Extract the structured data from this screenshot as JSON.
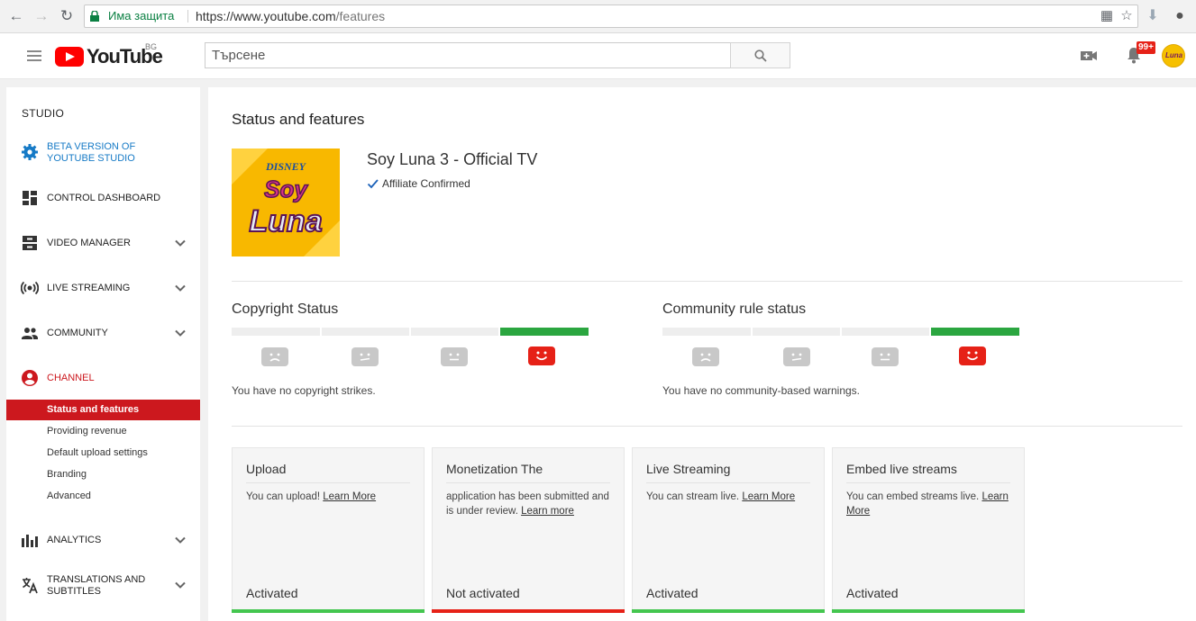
{
  "browser": {
    "secure_text": "Има защита",
    "url_host": "https://www.youtube.com",
    "url_path": "/features"
  },
  "masthead": {
    "logo_text": "YouTube",
    "region": "BG",
    "search_placeholder": "Търсене",
    "notification_count": "99+",
    "avatar_text": "Luna"
  },
  "sidebar": {
    "studio_label": "STUDIO",
    "items": [
      {
        "label": "BETA VERSION OF YOUTUBE STUDIO",
        "icon": "gear-icon"
      },
      {
        "label": "CONTROL DASHBOARD",
        "icon": "dashboard-icon"
      },
      {
        "label": "VIDEO MANAGER",
        "icon": "video-manager-icon"
      },
      {
        "label": "LIVE STREAMING",
        "icon": "live-icon"
      },
      {
        "label": "COMMUNITY",
        "icon": "people-icon"
      },
      {
        "label": "CHANNEL",
        "icon": "account-icon"
      },
      {
        "label": "ANALYTICS",
        "icon": "bar-chart-icon"
      },
      {
        "label": "TRANSLATIONS AND SUBTITLES",
        "icon": "translate-icon"
      }
    ],
    "channel_sub": [
      "Status and features",
      "Providing revenue",
      "Default upload settings",
      "Branding",
      "Advanced"
    ]
  },
  "main": {
    "title": "Status and features",
    "channel_name": "Soy Luna 3 - Official TV",
    "affiliate": "Affiliate Confirmed",
    "thumbnail_text": [
      "DISNEY",
      "Soy",
      "Luna"
    ],
    "copyright": {
      "title": "Copyright Status",
      "note": "You have no copyright strikes.",
      "level": 4
    },
    "community": {
      "title": "Community rule status",
      "note": "You have no community-based warnings.",
      "level": 4
    },
    "cards": [
      {
        "title": "Upload",
        "text": "You can upload! ",
        "link": "Learn More",
        "state": "Activated",
        "active": true
      },
      {
        "title": "Monetization The",
        "text": "application has been submitted and is under review. ",
        "link": "Learn more",
        "state": "Not activated",
        "active": false
      },
      {
        "title": "Live Streaming",
        "text": "You can stream live. ",
        "link": "Learn More",
        "state": "Activated",
        "active": true
      },
      {
        "title": "Embed live streams",
        "text": "You can embed streams live. ",
        "link": "Learn More",
        "state": "Activated",
        "active": true
      }
    ]
  },
  "colors": {
    "accent_red": "#cc181e",
    "green": "#2ba640",
    "link_blue": "#167ac6"
  }
}
